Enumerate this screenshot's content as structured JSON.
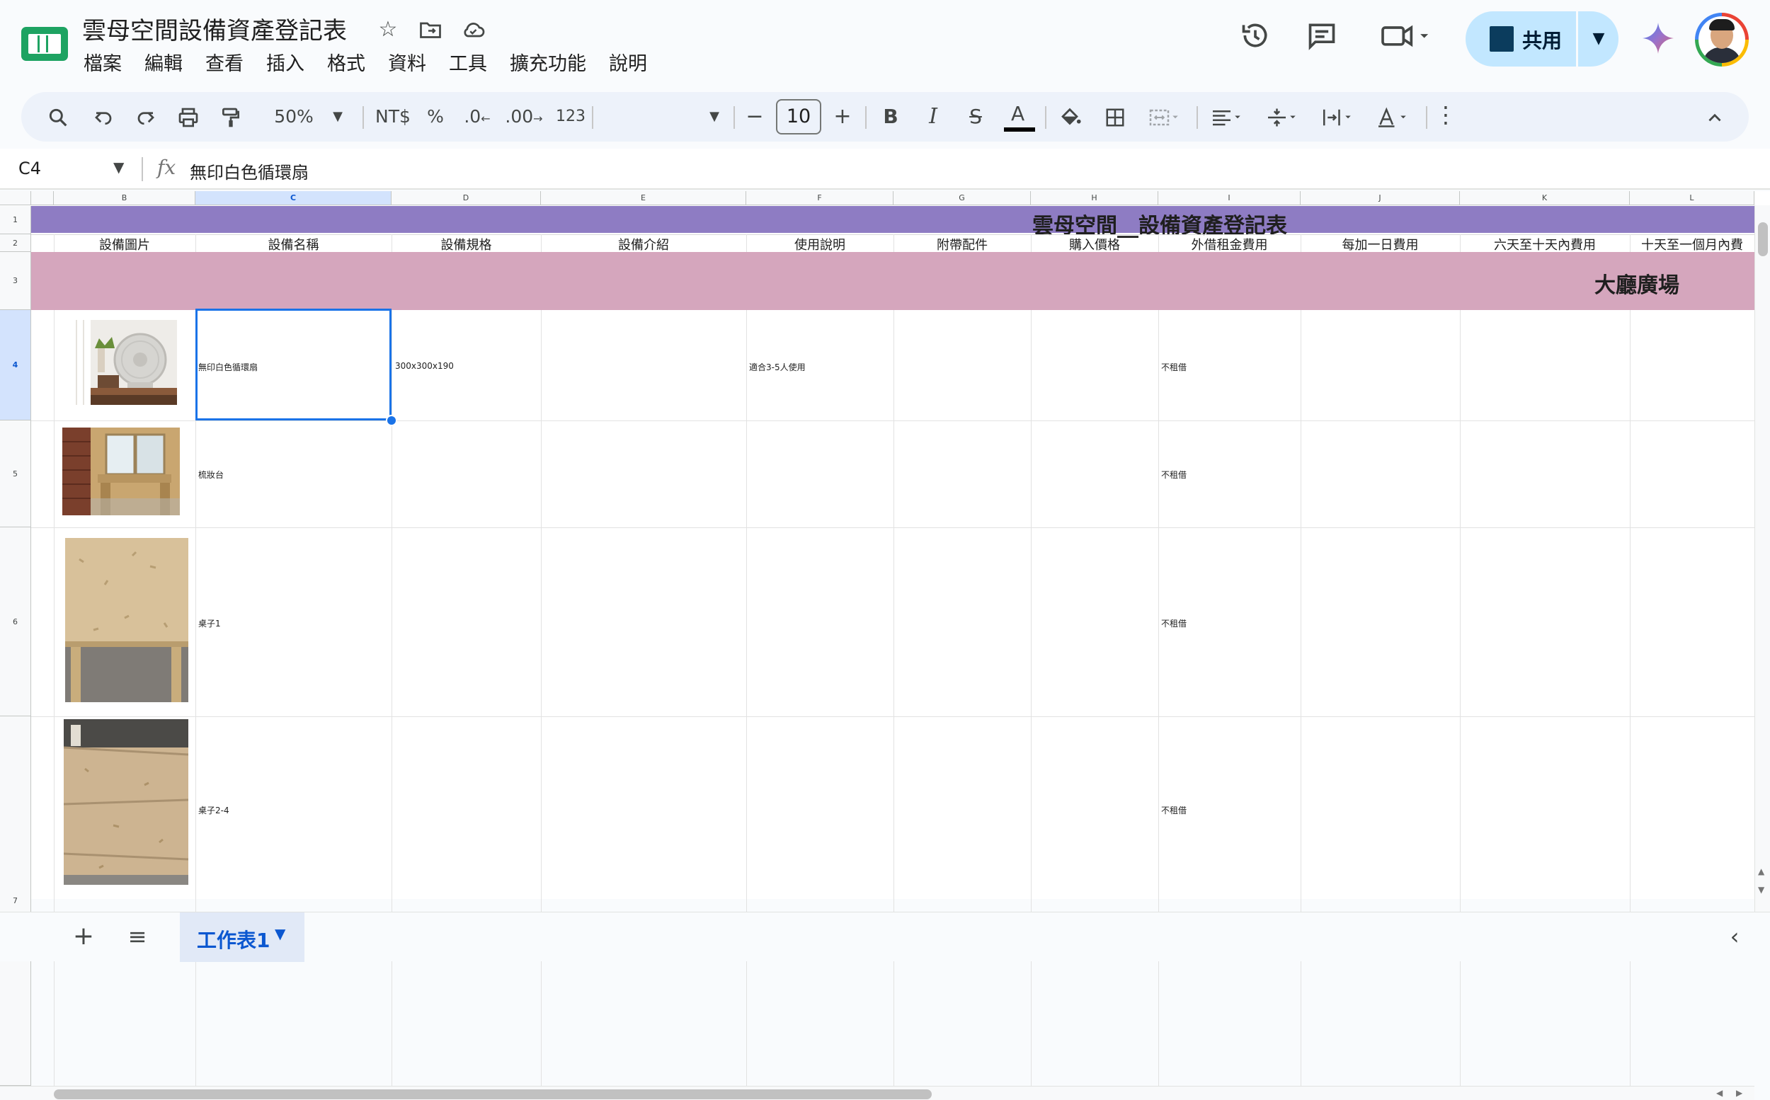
{
  "header": {
    "doc_title": "雲母空間設備資產登記表",
    "menu": [
      "檔案",
      "編輯",
      "查看",
      "插入",
      "格式",
      "資料",
      "工具",
      "擴充功能",
      "說明"
    ],
    "share_label": "共用"
  },
  "toolbar": {
    "zoom": "50%",
    "currency": "NT$",
    "percent": "%",
    "decrease_decimal": ".0",
    "increase_decimal": ".00",
    "number_format": "123",
    "font_size": "10",
    "bold": "B",
    "italic": "I",
    "text_color": "A"
  },
  "formula_bar": {
    "cell_ref": "C4",
    "fx": "fx",
    "content": "無印白色循環扇"
  },
  "columns": [
    "B",
    "C",
    "D",
    "E",
    "F",
    "G",
    "H",
    "I",
    "J",
    "K",
    "L"
  ],
  "rows": [
    "1",
    "2",
    "3",
    "4",
    "5",
    "6",
    "7"
  ],
  "sheet": {
    "title": "雲母空間__設備資產登記表",
    "headers": [
      "設備圖片",
      "設備名稱",
      "設備規格",
      "設備介紹",
      "使用說明",
      "附帶配件",
      "購入價格",
      "外借租金費用",
      "每加一日費用",
      "六天至十天內費用",
      "十天至一個月內費"
    ],
    "section": "大廳廣場",
    "items": [
      {
        "name": "無印白色循環扇",
        "spec": "300x300x190",
        "usage": "適合3-5人使用",
        "rent": "不租借"
      },
      {
        "name": "梳妝台",
        "spec": "",
        "usage": "",
        "rent": "不租借"
      },
      {
        "name": "桌子1",
        "spec": "",
        "usage": "",
        "rent": "不租借"
      },
      {
        "name": "桌子2-4",
        "spec": "",
        "usage": "",
        "rent": "不租借"
      }
    ]
  },
  "bottom": {
    "sheet_tab": "工作表1"
  },
  "colors": {
    "title_row": "#8e7cc3",
    "section_row": "#d5a6bd",
    "selection": "#1a73e8",
    "share_button": "#c2e7ff"
  }
}
